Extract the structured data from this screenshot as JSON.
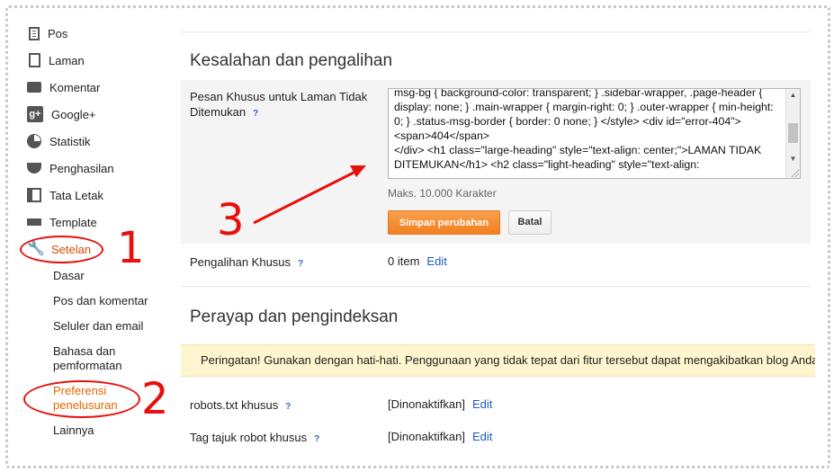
{
  "sidebar": {
    "items": [
      {
        "label": "Pos",
        "icon": "document-icon"
      },
      {
        "label": "Laman",
        "icon": "page-icon"
      },
      {
        "label": "Komentar",
        "icon": "comment-icon"
      },
      {
        "label": "Google+",
        "icon": "google-plus-icon"
      },
      {
        "label": "Statistik",
        "icon": "pie-chart-icon"
      },
      {
        "label": "Penghasilan",
        "icon": "trophy-icon"
      },
      {
        "label": "Tata Letak",
        "icon": "layout-icon"
      },
      {
        "label": "Template",
        "icon": "paint-roller-icon"
      },
      {
        "label": "Setelan",
        "icon": "wrench-icon"
      }
    ],
    "subitems": [
      {
        "label": "Dasar"
      },
      {
        "label": "Pos dan komentar"
      },
      {
        "label": "Seluler dan email"
      },
      {
        "label": "Bahasa dan\npemformatan"
      },
      {
        "label": "Preferensi\npenelusuran"
      },
      {
        "label": "Lainnya"
      }
    ]
  },
  "errors_section": {
    "title": "Kesalahan dan pengalihan",
    "custom_404_label": "Pesan Khusus untuk Laman Tidak\nDitemukan",
    "help": "?",
    "textarea_value": "msg-bg { background-color: transparent; } .sidebar-wrapper, .page-header { display: none; } .main-wrapper { margin-right: 0; } .outer-wrapper { min-height: 0; } .status-msg-border { border: 0 none; } </style> <div id=\"error-404\"> <span>404</span>\n</div> <h1 class=\"large-heading\" style=\"text-align: center;\">LAMAN TIDAK DITEMUKAN</h1> <h2 class=\"light-heading\" style=\"text-align:",
    "max_chars": "Maks. 10.000 Karakter",
    "save_label": "Simpan perubahan",
    "cancel_label": "Batal",
    "redirect_label": "Pengalihan Khusus",
    "redirect_value": "0 item",
    "edit_label": "Edit"
  },
  "crawl_section": {
    "title": "Perayap dan pengindeksan",
    "warning": "Peringatan! Gunakan dengan hati-hati. Penggunaan yang tidak tepat dari fitur tersebut dapat mengakibatkan blog Anda",
    "robots_label": "robots.txt khusus",
    "robots_value": "[Dinonaktifkan]",
    "robot_tags_label": "Tag tajuk robot khusus",
    "robot_tags_value": "[Dinonaktifkan]",
    "edit_label": "Edit",
    "help": "?"
  },
  "annotations": {
    "step1": "1",
    "step2": "2",
    "step3": "3",
    "color": "#e8100d"
  },
  "colors": {
    "accent": "#e56500",
    "link": "#1e5bbf",
    "button_orange": "#f27f20",
    "warning_bg": "#fff5cf"
  }
}
